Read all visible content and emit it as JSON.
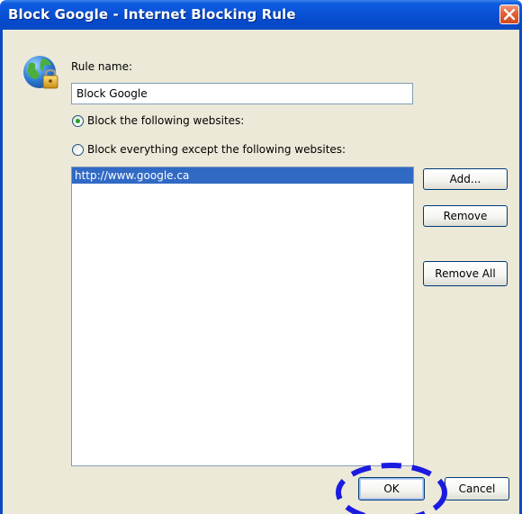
{
  "window": {
    "title": "Block Google - Internet Blocking Rule",
    "close_icon": "close-icon"
  },
  "rule": {
    "name_label": "Rule name:",
    "name_value": "Block Google"
  },
  "options": {
    "block_following_label": "Block the following websites:",
    "block_following_checked": true,
    "block_except_label": "Block everything except the following websites:",
    "block_except_checked": false
  },
  "websites": {
    "items": [
      "http://www.google.ca"
    ],
    "selected_index": 0
  },
  "buttons": {
    "add_label": "Add...",
    "remove_label": "Remove",
    "remove_all_label": "Remove All",
    "ok_label": "OK",
    "cancel_label": "Cancel"
  },
  "colors": {
    "titlebar": "#0a52d6",
    "dialog_background": "#ece9d8",
    "selection": "#316ac5",
    "annotation": "#1a1ae0"
  }
}
